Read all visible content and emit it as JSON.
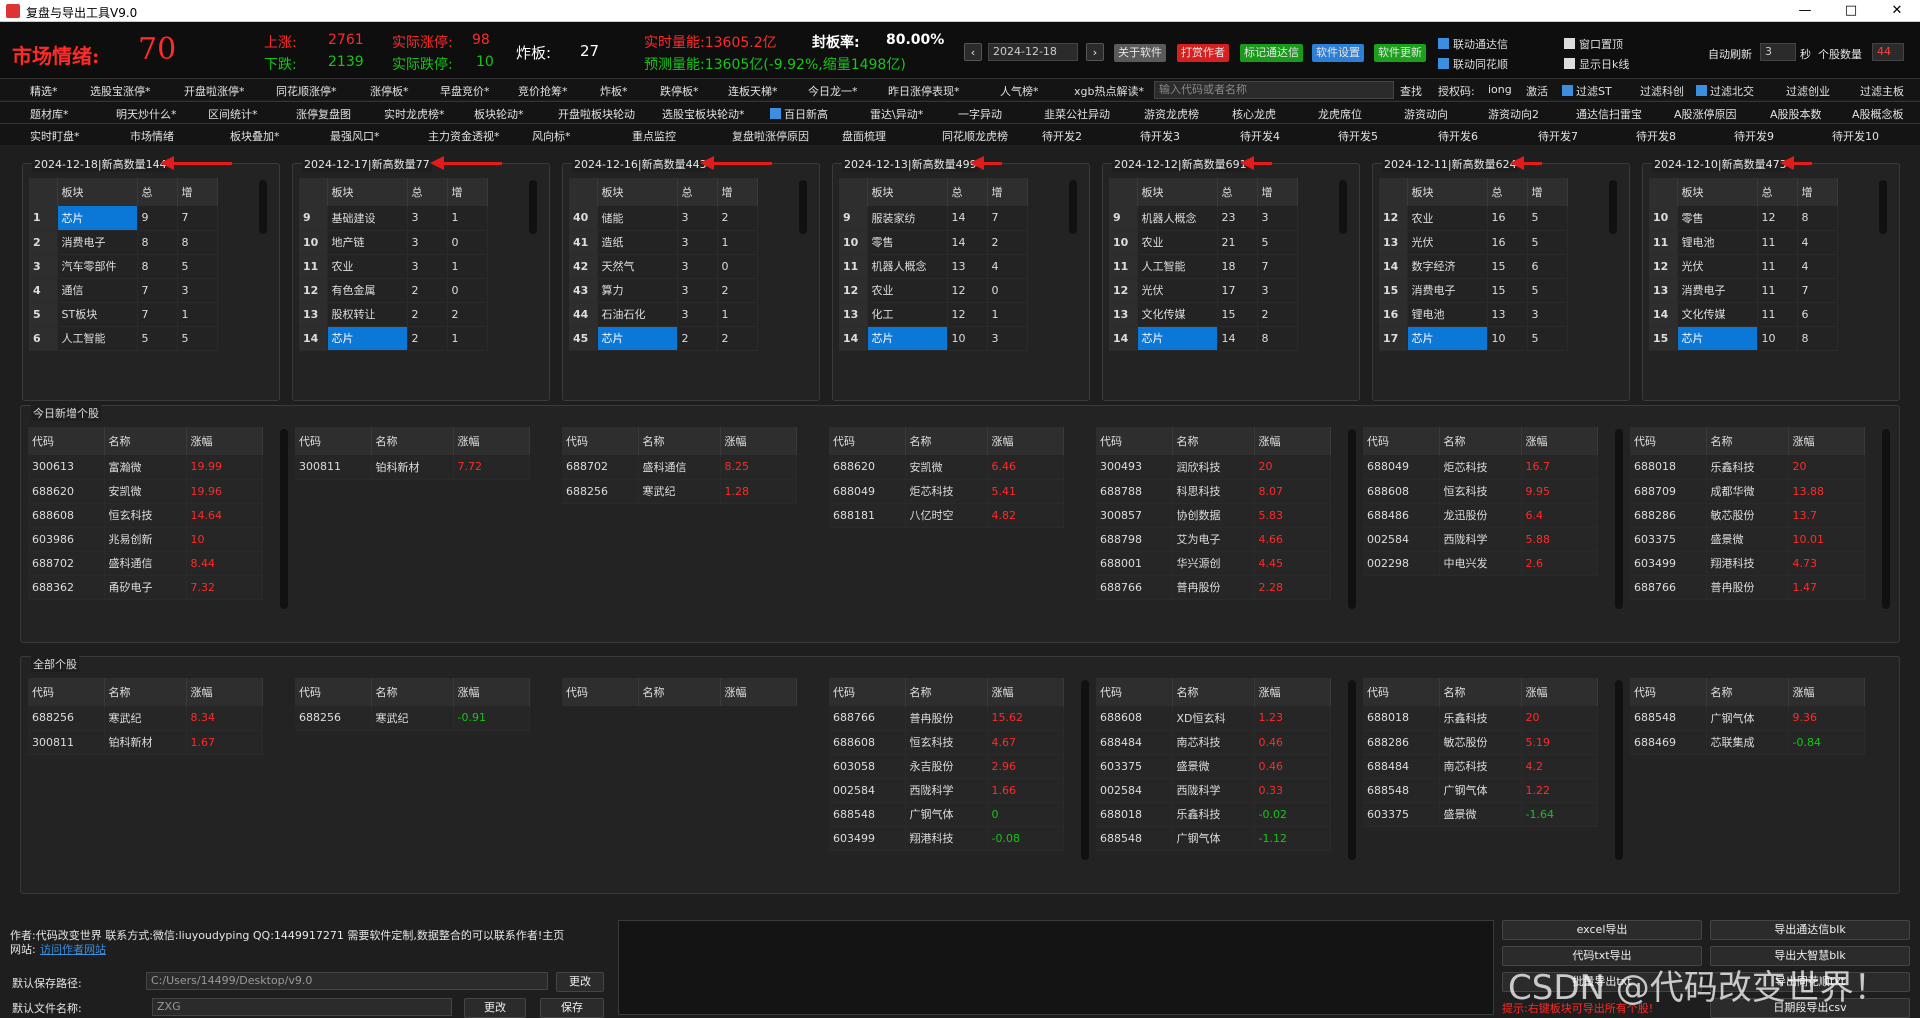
{
  "window": {
    "title": "复盘与导出工具V9.0",
    "min": "—",
    "max": "□",
    "close": "✕"
  },
  "status": {
    "sentiment_label": "市场情绪:",
    "sentiment_value": "70",
    "up_label": "上涨:",
    "up_value": "2761",
    "limit_up_label": "实际涨停:",
    "limit_up_value": "98",
    "down_label": "下跌:",
    "down_value": "2139",
    "limit_down_label": "实际跌停:",
    "limit_down_value": "10",
    "broken_label": "炸板:",
    "broken_value": "27",
    "realtime_vol": "实时量能:13605.2亿",
    "seal_rate_label": "封板率:",
    "seal_rate_value": "80.00%",
    "predict_vol": "预测量能:13605亿(-9.92%,缩量1498亿)"
  },
  "toolbar": {
    "prev": "‹",
    "date": "2024-12-18",
    "next": "›",
    "about": "关于软件",
    "reward": "打赏作者",
    "mark": "标记通达信",
    "settings": "软件设置",
    "update": "软件更新",
    "link_tdx": "联动通达信",
    "link_ths": "联动同花顺",
    "window_top": "窗口置顶",
    "show_day": "显示日k线",
    "auto_refresh": "自动刷新",
    "refresh_sec": "3",
    "sec": "秒",
    "stock_count_label": "个股数量",
    "stock_count": "44",
    "colors": {
      "about": "#5a5a5a",
      "reward": "#d62020",
      "mark": "#1a9a1a",
      "settings": "#2c7fd6",
      "update": "#1aa01a"
    }
  },
  "nav1": [
    "精选*",
    "选股宝涨停*",
    "开盘啦涨停*",
    "同花顺涨停*",
    "涨停板*",
    "早盘竞价*",
    "竞价抢筹*",
    "炸板*",
    "跌停板*",
    "连板天梯*",
    "今日龙一*",
    "昨日涨停表现*",
    "人气榜*",
    "xgb热点解读*"
  ],
  "nav1_search_placeholder": "输入代码或者名称",
  "nav1_right": {
    "search": "查找",
    "auth_label": "授权码:",
    "auth_value": "iong",
    "activate": "激活",
    "f1": "过滤ST",
    "f2": "过滤科创",
    "f3": "过滤北交",
    "f4": "过滤创业",
    "f5": "过滤主板"
  },
  "nav2": [
    "题材库*",
    "明天炒什么*",
    "区间统计*",
    "涨停复盘图",
    "实时龙虎榜*",
    "板块轮动*",
    "开盘啦板块轮动",
    "选股宝板块轮动*",
    "百日新高",
    "雷达\\异动*",
    "一字异动",
    "韭菜公社异动",
    "游资龙虎榜",
    "核心龙虎",
    "龙虎席位",
    "游资动向",
    "游资动向2",
    "通达信扫雷宝",
    "A股涨停原因",
    "A股股本数",
    "A股概念板"
  ],
  "nav3": [
    "实时盯盘*",
    "市场情绪",
    "板块叠加*",
    "最强风口*",
    "主力资金透视*",
    "风向标*",
    "重点监控",
    "复盘啦涨停原因",
    "盘面梳理",
    "同花顺龙虎榜",
    "待开发2",
    "待开发3",
    "待开发4",
    "待开发5",
    "待开发6",
    "待开发7",
    "待开发8",
    "待开发9",
    "待开发10"
  ],
  "sector_panels": [
    {
      "title": "2024-12-18|新高数量144",
      "h": [
        "板块",
        "总",
        "增"
      ],
      "rows": [
        [
          "1",
          "芯片",
          "9",
          "7"
        ],
        [
          "2",
          "消费电子",
          "8",
          "8"
        ],
        [
          "3",
          "汽车零部件",
          "8",
          "5"
        ],
        [
          "4",
          "通信",
          "7",
          "3"
        ],
        [
          "5",
          "ST板块",
          "7",
          "1"
        ],
        [
          "6",
          "人工智能",
          "5",
          "5"
        ]
      ],
      "sel": 0
    },
    {
      "title": "2024-12-17|新高数量77",
      "h": [
        "板块",
        "总",
        "增"
      ],
      "rows": [
        [
          "9",
          "基础建设",
          "3",
          "1"
        ],
        [
          "10",
          "地产链",
          "3",
          "0"
        ],
        [
          "11",
          "农业",
          "3",
          "1"
        ],
        [
          "12",
          "有色金属",
          "2",
          "0"
        ],
        [
          "13",
          "股权转让",
          "2",
          "2"
        ],
        [
          "14",
          "芯片",
          "2",
          "1"
        ]
      ],
      "sel": 5
    },
    {
      "title": "2024-12-16|新高数量443",
      "h": [
        "板块",
        "总",
        "增"
      ],
      "rows": [
        [
          "40",
          "储能",
          "3",
          "2"
        ],
        [
          "41",
          "造纸",
          "3",
          "1"
        ],
        [
          "42",
          "天然气",
          "3",
          "0"
        ],
        [
          "43",
          "算力",
          "3",
          "2"
        ],
        [
          "44",
          "石油石化",
          "3",
          "1"
        ],
        [
          "45",
          "芯片",
          "2",
          "2"
        ]
      ],
      "sel": 5
    },
    {
      "title": "2024-12-13|新高数量499",
      "h": [
        "板块",
        "总",
        "增"
      ],
      "rows": [
        [
          "9",
          "服装家纺",
          "14",
          "7"
        ],
        [
          "10",
          "零售",
          "14",
          "2"
        ],
        [
          "11",
          "机器人概念",
          "13",
          "4"
        ],
        [
          "12",
          "农业",
          "12",
          "0"
        ],
        [
          "13",
          "化工",
          "12",
          "1"
        ],
        [
          "14",
          "芯片",
          "10",
          "3"
        ]
      ],
      "sel": 5
    },
    {
      "title": "2024-12-12|新高数量691",
      "h": [
        "板块",
        "总",
        "增"
      ],
      "rows": [
        [
          "9",
          "机器人概念",
          "23",
          "3"
        ],
        [
          "10",
          "农业",
          "21",
          "5"
        ],
        [
          "11",
          "人工智能",
          "18",
          "7"
        ],
        [
          "12",
          "光伏",
          "17",
          "3"
        ],
        [
          "13",
          "文化传媒",
          "15",
          "2"
        ],
        [
          "14",
          "芯片",
          "14",
          "8"
        ]
      ],
      "sel": 5
    },
    {
      "title": "2024-12-11|新高数量624",
      "h": [
        "板块",
        "总",
        "增"
      ],
      "rows": [
        [
          "12",
          "农业",
          "16",
          "5"
        ],
        [
          "13",
          "光伏",
          "16",
          "5"
        ],
        [
          "14",
          "数字经济",
          "15",
          "6"
        ],
        [
          "15",
          "消费电子",
          "15",
          "5"
        ],
        [
          "16",
          "锂电池",
          "13",
          "3"
        ],
        [
          "17",
          "芯片",
          "10",
          "5"
        ]
      ],
      "sel": 5
    },
    {
      "title": "2024-12-10|新高数量473",
      "h": [
        "板块",
        "总",
        "增"
      ],
      "rows": [
        [
          "10",
          "零售",
          "12",
          "8"
        ],
        [
          "11",
          "锂电池",
          "11",
          "4"
        ],
        [
          "12",
          "光伏",
          "11",
          "4"
        ],
        [
          "13",
          "消费电子",
          "11",
          "7"
        ],
        [
          "14",
          "文化传媒",
          "11",
          "6"
        ],
        [
          "15",
          "芯片",
          "10",
          "8"
        ]
      ],
      "sel": 5
    }
  ],
  "new_stocks_title": "今日新增个股",
  "stock_head": [
    "代码",
    "名称",
    "涨幅"
  ],
  "new_stocks": [
    [
      [
        "300613",
        "富瀚微",
        "19.99"
      ],
      [
        "688620",
        "安凯微",
        "19.96"
      ],
      [
        "688608",
        "恒玄科技",
        "14.64"
      ],
      [
        "603986",
        "兆易创新",
        "10"
      ],
      [
        "688702",
        "盛科通信",
        "8.44"
      ],
      [
        "688362",
        "甬矽电子",
        "7.32"
      ]
    ],
    [
      [
        "300811",
        "铂科新材",
        "7.72"
      ]
    ],
    [
      [
        "688702",
        "盛科通信",
        "8.25"
      ],
      [
        "688256",
        "寒武纪",
        "1.28"
      ]
    ],
    [
      [
        "688620",
        "安凯微",
        "6.46"
      ],
      [
        "688049",
        "炬芯科技",
        "5.41"
      ],
      [
        "688181",
        "八亿时空",
        "4.82"
      ]
    ],
    [
      [
        "300493",
        "润欣科技",
        "20"
      ],
      [
        "688788",
        "科思科技",
        "8.07"
      ],
      [
        "300857",
        "协创数据",
        "5.83"
      ],
      [
        "688798",
        "艾为电子",
        "4.66"
      ],
      [
        "688001",
        "华兴源创",
        "4.45"
      ],
      [
        "688766",
        "普冉股份",
        "2.28"
      ]
    ],
    [
      [
        "688049",
        "炬芯科技",
        "16.7"
      ],
      [
        "688608",
        "恒玄科技",
        "9.95"
      ],
      [
        "688486",
        "龙迅股份",
        "6.4"
      ],
      [
        "002584",
        "西陇科学",
        "5.88"
      ],
      [
        "002298",
        "中电兴发",
        "2.6"
      ]
    ],
    [
      [
        "688018",
        "乐鑫科技",
        "20"
      ],
      [
        "688709",
        "成都华微",
        "13.88"
      ],
      [
        "688286",
        "敏芯股份",
        "13.7"
      ],
      [
        "603375",
        "盛景微",
        "10.01"
      ],
      [
        "603499",
        "翔港科技",
        "4.73"
      ],
      [
        "688766",
        "普冉股份",
        "1.47"
      ]
    ]
  ],
  "all_stocks_title": "全部个股",
  "all_stocks": [
    [
      [
        "688256",
        "寒武纪",
        "8.34"
      ],
      [
        "300811",
        "铂科新材",
        "1.67"
      ]
    ],
    [
      [
        "688256",
        "寒武纪",
        "-0.91"
      ]
    ],
    [],
    [
      [
        "688766",
        "普冉股份",
        "15.62"
      ],
      [
        "688608",
        "恒玄科技",
        "4.67"
      ],
      [
        "603058",
        "永吉股份",
        "2.96"
      ],
      [
        "002584",
        "西陇科学",
        "1.66"
      ],
      [
        "688548",
        "广钢气体",
        "0"
      ],
      [
        "603499",
        "翔港科技",
        "-0.08"
      ]
    ],
    [
      [
        "688608",
        "XD恒玄科",
        "1.23"
      ],
      [
        "688484",
        "南芯科技",
        "0.46"
      ],
      [
        "603375",
        "盛景微",
        "0.46"
      ],
      [
        "002584",
        "西陇科学",
        "0.33"
      ],
      [
        "688018",
        "乐鑫科技",
        "-0.02"
      ],
      [
        "688548",
        "广钢气体",
        "-1.12"
      ]
    ],
    [
      [
        "688018",
        "乐鑫科技",
        "20"
      ],
      [
        "688286",
        "敏芯股份",
        "5.19"
      ],
      [
        "688484",
        "南芯科技",
        "4.2"
      ],
      [
        "688548",
        "广钢气体",
        "1.22"
      ],
      [
        "603375",
        "盛景微",
        "-1.64"
      ]
    ],
    [
      [
        "688548",
        "广钢气体",
        "9.36"
      ],
      [
        "688469",
        "芯联集成",
        "-0.84"
      ]
    ]
  ],
  "footer": {
    "author": "作者:代码改变世界 联系方式:微信:liuyoudyping QQ:1449917271 需要软件定制,数据整合的可以联系作者!主页",
    "site_label": "网站:",
    "site_link": "访问作者网站",
    "save_path_label": "默认保存路径:",
    "save_path": "C:/Users/14499/Desktop/v9.0",
    "change": "更改",
    "file_name_label": "默认文件名称:",
    "file_name": "ZXG",
    "change2": "更改",
    "save": "保存",
    "btn_excel": "excel导出",
    "btn_tdx_blk": "导出通达信blk",
    "btn_txt": "代码txt导出",
    "btn_dzh": "导出大智慧blk",
    "btn_batch": "批量导出txt",
    "btn_ths": "导出同花顺txt",
    "btn_csv": "日期段导出csv",
    "tip": "提示:右键板块可导出所有个股!",
    "watermark": "CSDN @代码改变世界！"
  }
}
